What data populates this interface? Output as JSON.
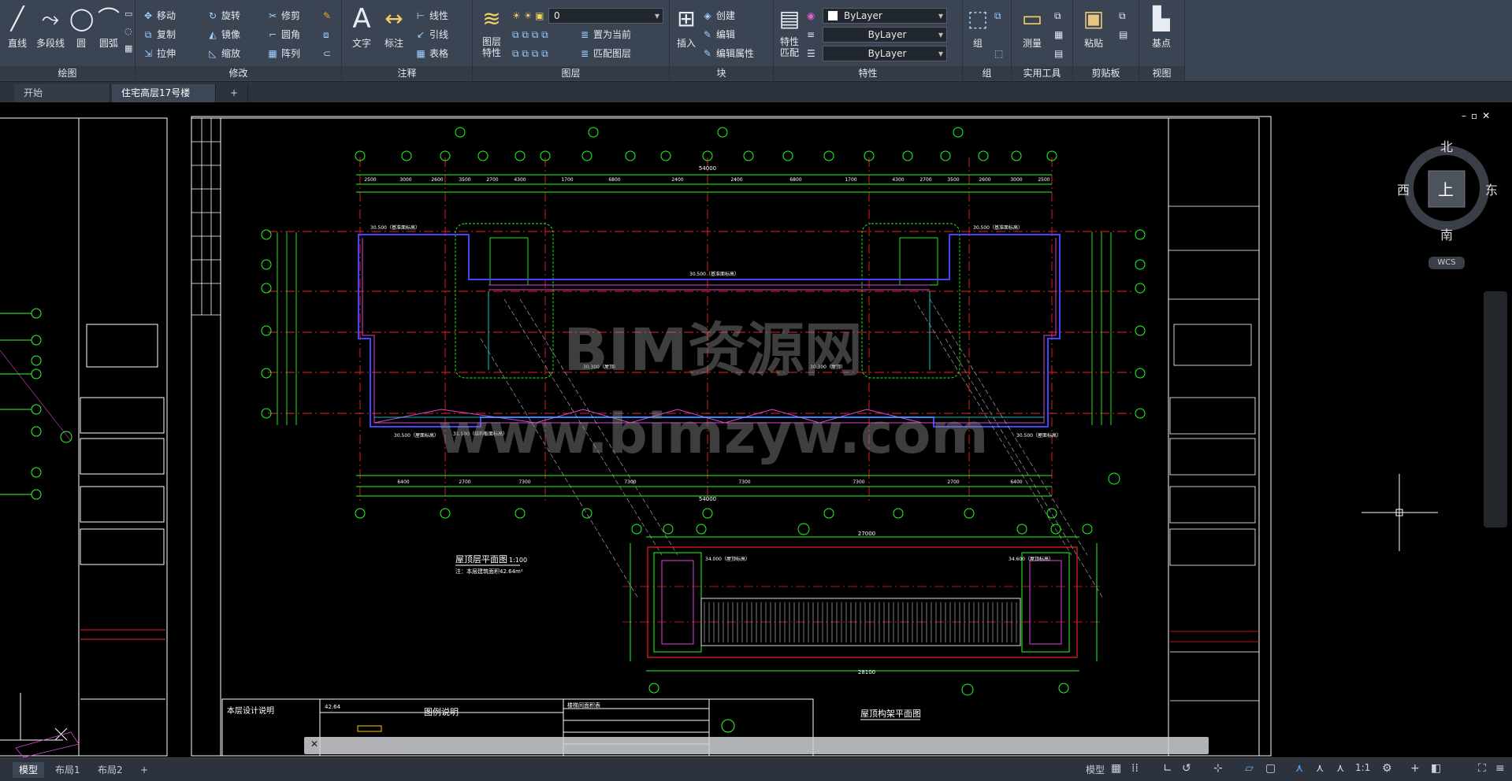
{
  "ribbon": {
    "draw": {
      "title": "绘图",
      "line": "直线",
      "polyline": "多段线",
      "circle": "圆",
      "arc": "圆弧"
    },
    "modify": {
      "title": "修改",
      "move": "移动",
      "rotate": "旋转",
      "trim": "修剪",
      "copy": "复制",
      "mirror": "镜像",
      "fillet": "圆角",
      "stretch": "拉伸",
      "scale": "缩放",
      "array": "阵列"
    },
    "annotation": {
      "title": "注释",
      "text": "文字",
      "dimension": "标注",
      "linear": "线性",
      "leader": "引线",
      "table": "表格"
    },
    "layers": {
      "title": "图层",
      "properties": "图层\n特性",
      "current_layer": "0",
      "make_current": "置为当前",
      "match_layer": "匹配图层"
    },
    "block": {
      "title": "块",
      "insert": "插入",
      "create": "创建",
      "edit": "编辑",
      "edit_attr": "编辑属性"
    },
    "properties": {
      "title": "特性",
      "match": "特性\n匹配",
      "color": "ByLayer",
      "linetype": "ByLayer",
      "lineweight": "ByLayer"
    },
    "groups": {
      "title": "组",
      "group": "组"
    },
    "utilities": {
      "title": "实用工具",
      "measure": "测量"
    },
    "clipboard": {
      "title": "剪贴板",
      "paste": "粘贴"
    },
    "view": {
      "title": "视图",
      "base": "基点"
    }
  },
  "file_tabs": [
    "开始",
    "住宅高层17号楼*"
  ],
  "layout_tabs": [
    "模型",
    "布局1",
    "布局2"
  ],
  "status": {
    "model": "模型",
    "scale": "1:1"
  },
  "viewcube": {
    "north": "北",
    "south": "南",
    "east": "东",
    "west": "西",
    "top": "上",
    "wcs": "WCS"
  },
  "watermark": {
    "line1": "BIM资源网",
    "line2": "www.bimzyw.com"
  },
  "drawing": {
    "roof_plan_title": "屋顶层平面图",
    "roof_plan_scale": "1:100",
    "roof_plan_note": "注：本层建筑面积42.64m²",
    "frame_plan_title": "屋顶构架平面图",
    "dim_total": "54000",
    "dim_total_frame": "27000",
    "dim_frame_bottom": "28100",
    "top_dims": [
      "2500",
      "3000",
      "2600",
      "3500",
      "2700",
      "4300",
      "1700",
      "6800",
      "2400",
      "2400",
      "6800",
      "1700",
      "4300",
      "2700",
      "3500",
      "2600",
      "3000",
      "2500"
    ],
    "bottom_dims": [
      "6400",
      "2700",
      "7300",
      "7300",
      "7300",
      "7300",
      "2700",
      "6400"
    ],
    "elevations": [
      "30.500（基准面标高）",
      "30.300（屋顶）",
      "34.000（屋顶标高）",
      "34.600（屋顶标高）",
      "31.500（结构板面标高）",
      "30.500（屋面标高）"
    ],
    "legend_title": "图例说明",
    "notes_title": "本层设计说明",
    "table_title": "楼梯间面积表",
    "area_value": "42.64"
  }
}
